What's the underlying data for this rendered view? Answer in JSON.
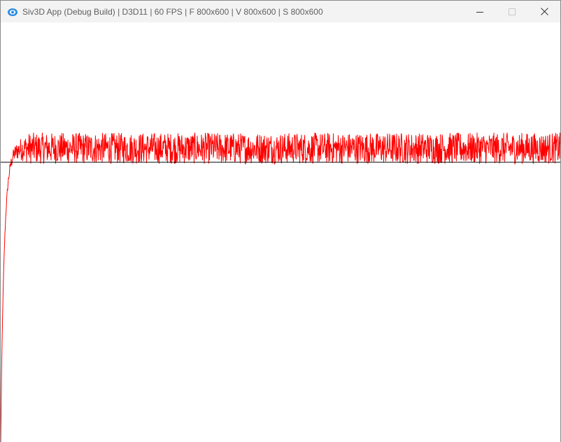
{
  "window": {
    "title": "Siv3D App (Debug Build) | D3D11 | 60 FPS | F 800x600 | V 800x600 | S 800x600",
    "icon": "siv3d-app-icon",
    "controls": [
      "minimize-icon",
      "maximize-icon",
      "close-icon"
    ]
  },
  "colors": {
    "titlebar_bg": "#f3f3f3",
    "canvas_bg": "#ffffff",
    "series": "#ff0000",
    "reference_line": "#000000"
  },
  "chart_data": {
    "type": "line",
    "grid": false,
    "x_range": [
      0,
      800
    ],
    "y_range": [
      0,
      600
    ],
    "reference_line": {
      "y": 400
    },
    "series": [
      {
        "color": "#ff0000",
        "description_values": {
          "start": 0,
          "settle_level": 412,
          "noise_range": [
            388,
            452
          ]
        }
      }
    ]
  }
}
